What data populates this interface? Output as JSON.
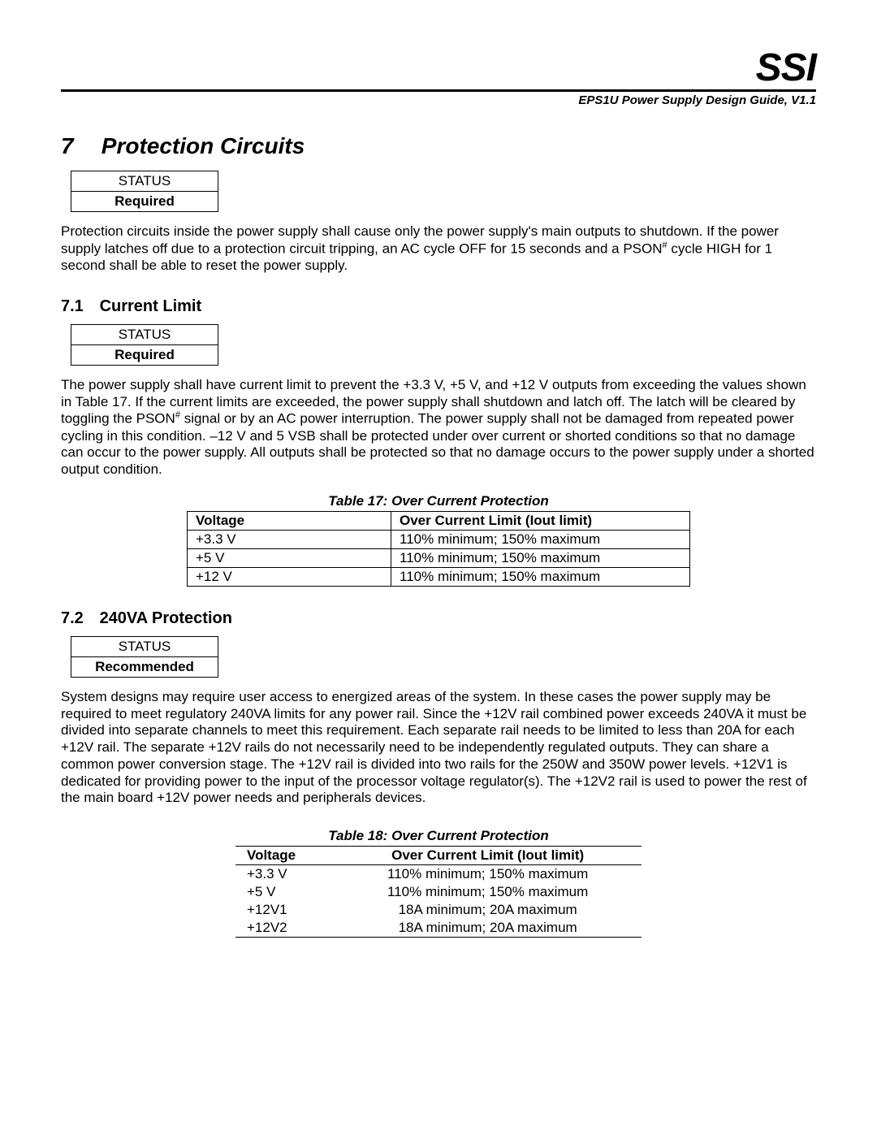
{
  "header": {
    "logo": "SSI",
    "doc_version": "EPS1U Power Supply Design Guide, V1.1"
  },
  "section": {
    "number": "7",
    "title": "Protection Circuits",
    "status_label": "STATUS",
    "status_value": "Required",
    "intro_html": "Protection circuits inside the power supply shall cause only the power supply's main outputs to shutdown.  If the power supply latches off due to a protection circuit tripping, an AC cycle OFF for 15 seconds and a PSON<sup>#</sup> cycle HIGH for 1 second shall be able to reset the power supply."
  },
  "s71": {
    "number": "7.1",
    "title": "Current Limit",
    "status_label": "STATUS",
    "status_value": "Required",
    "body_html": "The power supply shall have current limit to prevent the +3.3 V, +5 V, and +12 V outputs from exceeding the values shown in Table 17.  If the current limits are exceeded, the power supply shall shutdown and latch off.  The latch will be cleared by toggling the PSON<sup>#</sup> signal or by an AC power interruption.  The power supply shall not be damaged from repeated power cycling in this condition.  –12 V and 5 VSB shall be protected under over current or shorted conditions so that no damage can occur to the power supply. All outputs shall be protected so that no damage occurs to the power supply under a shorted output condition."
  },
  "table17": {
    "caption": "Table 17:  Over Current Protection",
    "headers": [
      "Voltage",
      "Over Current Limit (Iout limit)"
    ],
    "rows": [
      [
        "+3.3 V",
        "110% minimum; 150% maximum"
      ],
      [
        "+5 V",
        "110% minimum; 150% maximum"
      ],
      [
        "+12 V",
        "110% minimum; 150% maximum"
      ]
    ]
  },
  "s72": {
    "number": "7.2",
    "title": "240VA Protection",
    "status_label": "STATUS",
    "status_value": "Recommended",
    "body": "System designs may require user access to energized areas of the system.  In these cases the power supply may be required to meet regulatory 240VA limits for any power rail.  Since the +12V rail combined power exceeds 240VA it must be divided into separate channels to meet this requirement.  Each separate rail needs to be limited to less than 20A for each +12V rail.  The separate +12V rails do not necessarily need to be independently regulated outputs.  They can share a common power conversion stage.  The +12V rail is divided into two rails for the 250W and 350W power levels.  +12V1 is dedicated for providing power to the input of the processor voltage regulator(s).  The +12V2 rail is used to power the rest of the main board +12V power needs and peripherals devices."
  },
  "table18": {
    "caption": "Table 18:  Over Current Protection",
    "headers": [
      "Voltage",
      "Over Current Limit (Iout limit)"
    ],
    "rows": [
      [
        "+3.3 V",
        "110% minimum; 150% maximum"
      ],
      [
        "+5 V",
        "110% minimum; 150% maximum"
      ],
      [
        "+12V1",
        "18A minimum; 20A maximum"
      ],
      [
        "+12V2",
        "18A minimum; 20A maximum"
      ]
    ]
  }
}
